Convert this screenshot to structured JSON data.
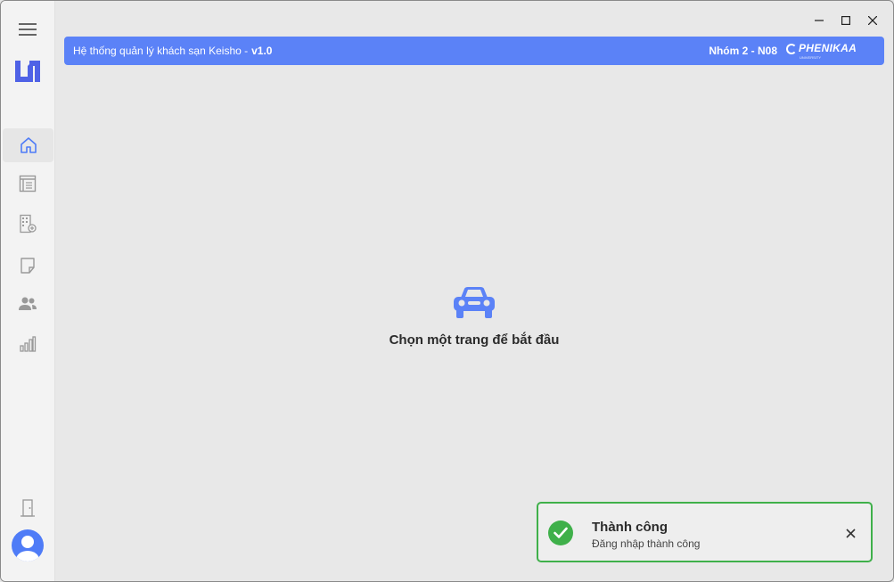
{
  "header": {
    "title": "Hệ thống quản lý khách sạn Keisho -",
    "version": "v1.0",
    "group": "Nhóm 2 - N08",
    "logo_text": "PHENIKAA",
    "logo_tagline": "UNIVERSITY"
  },
  "sidebar": {
    "items": [
      {
        "icon": "menu-icon"
      },
      {
        "icon": "app-logo-icon"
      },
      {
        "icon": "home-icon",
        "active": true
      },
      {
        "icon": "list-icon"
      },
      {
        "icon": "building-add-icon"
      },
      {
        "icon": "note-icon"
      },
      {
        "icon": "people-icon"
      },
      {
        "icon": "chart-icon"
      },
      {
        "icon": "door-icon"
      },
      {
        "icon": "avatar-icon"
      }
    ]
  },
  "window_controls": {
    "minimize": "–",
    "maximize": "□",
    "close": "✕"
  },
  "main": {
    "icon": "car-icon",
    "message": "Chọn một trang để bắt đầu"
  },
  "toast": {
    "title": "Thành công",
    "message": "Đăng nhập thành công",
    "status_color": "#3fb04a"
  },
  "colors": {
    "accent": "#5b82f7",
    "success": "#3fb04a"
  }
}
